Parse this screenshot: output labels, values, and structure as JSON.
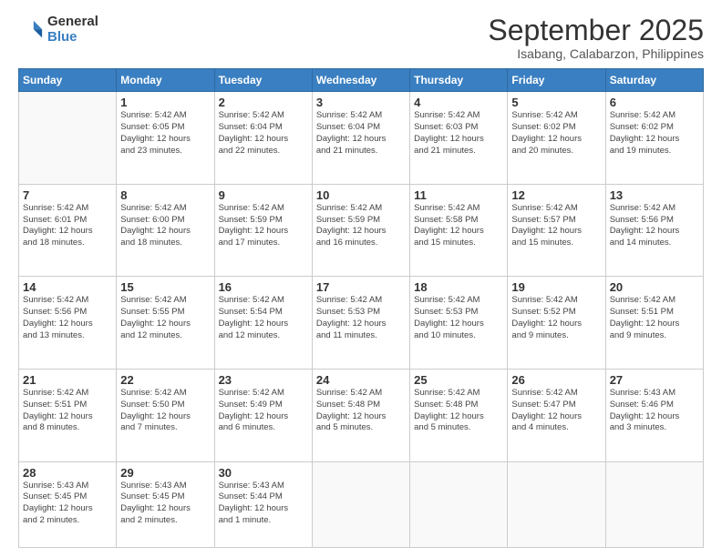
{
  "logo": {
    "general": "General",
    "blue": "Blue"
  },
  "title": "September 2025",
  "subtitle": "Isabang, Calabarzon, Philippines",
  "header_days": [
    "Sunday",
    "Monday",
    "Tuesday",
    "Wednesday",
    "Thursday",
    "Friday",
    "Saturday"
  ],
  "weeks": [
    [
      {
        "day": "",
        "info": ""
      },
      {
        "day": "1",
        "info": "Sunrise: 5:42 AM\nSunset: 6:05 PM\nDaylight: 12 hours\nand 23 minutes."
      },
      {
        "day": "2",
        "info": "Sunrise: 5:42 AM\nSunset: 6:04 PM\nDaylight: 12 hours\nand 22 minutes."
      },
      {
        "day": "3",
        "info": "Sunrise: 5:42 AM\nSunset: 6:04 PM\nDaylight: 12 hours\nand 21 minutes."
      },
      {
        "day": "4",
        "info": "Sunrise: 5:42 AM\nSunset: 6:03 PM\nDaylight: 12 hours\nand 21 minutes."
      },
      {
        "day": "5",
        "info": "Sunrise: 5:42 AM\nSunset: 6:02 PM\nDaylight: 12 hours\nand 20 minutes."
      },
      {
        "day": "6",
        "info": "Sunrise: 5:42 AM\nSunset: 6:02 PM\nDaylight: 12 hours\nand 19 minutes."
      }
    ],
    [
      {
        "day": "7",
        "info": "Sunrise: 5:42 AM\nSunset: 6:01 PM\nDaylight: 12 hours\nand 18 minutes."
      },
      {
        "day": "8",
        "info": "Sunrise: 5:42 AM\nSunset: 6:00 PM\nDaylight: 12 hours\nand 18 minutes."
      },
      {
        "day": "9",
        "info": "Sunrise: 5:42 AM\nSunset: 5:59 PM\nDaylight: 12 hours\nand 17 minutes."
      },
      {
        "day": "10",
        "info": "Sunrise: 5:42 AM\nSunset: 5:59 PM\nDaylight: 12 hours\nand 16 minutes."
      },
      {
        "day": "11",
        "info": "Sunrise: 5:42 AM\nSunset: 5:58 PM\nDaylight: 12 hours\nand 15 minutes."
      },
      {
        "day": "12",
        "info": "Sunrise: 5:42 AM\nSunset: 5:57 PM\nDaylight: 12 hours\nand 15 minutes."
      },
      {
        "day": "13",
        "info": "Sunrise: 5:42 AM\nSunset: 5:56 PM\nDaylight: 12 hours\nand 14 minutes."
      }
    ],
    [
      {
        "day": "14",
        "info": "Sunrise: 5:42 AM\nSunset: 5:56 PM\nDaylight: 12 hours\nand 13 minutes."
      },
      {
        "day": "15",
        "info": "Sunrise: 5:42 AM\nSunset: 5:55 PM\nDaylight: 12 hours\nand 12 minutes."
      },
      {
        "day": "16",
        "info": "Sunrise: 5:42 AM\nSunset: 5:54 PM\nDaylight: 12 hours\nand 12 minutes."
      },
      {
        "day": "17",
        "info": "Sunrise: 5:42 AM\nSunset: 5:53 PM\nDaylight: 12 hours\nand 11 minutes."
      },
      {
        "day": "18",
        "info": "Sunrise: 5:42 AM\nSunset: 5:53 PM\nDaylight: 12 hours\nand 10 minutes."
      },
      {
        "day": "19",
        "info": "Sunrise: 5:42 AM\nSunset: 5:52 PM\nDaylight: 12 hours\nand 9 minutes."
      },
      {
        "day": "20",
        "info": "Sunrise: 5:42 AM\nSunset: 5:51 PM\nDaylight: 12 hours\nand 9 minutes."
      }
    ],
    [
      {
        "day": "21",
        "info": "Sunrise: 5:42 AM\nSunset: 5:51 PM\nDaylight: 12 hours\nand 8 minutes."
      },
      {
        "day": "22",
        "info": "Sunrise: 5:42 AM\nSunset: 5:50 PM\nDaylight: 12 hours\nand 7 minutes."
      },
      {
        "day": "23",
        "info": "Sunrise: 5:42 AM\nSunset: 5:49 PM\nDaylight: 12 hours\nand 6 minutes."
      },
      {
        "day": "24",
        "info": "Sunrise: 5:42 AM\nSunset: 5:48 PM\nDaylight: 12 hours\nand 5 minutes."
      },
      {
        "day": "25",
        "info": "Sunrise: 5:42 AM\nSunset: 5:48 PM\nDaylight: 12 hours\nand 5 minutes."
      },
      {
        "day": "26",
        "info": "Sunrise: 5:42 AM\nSunset: 5:47 PM\nDaylight: 12 hours\nand 4 minutes."
      },
      {
        "day": "27",
        "info": "Sunrise: 5:43 AM\nSunset: 5:46 PM\nDaylight: 12 hours\nand 3 minutes."
      }
    ],
    [
      {
        "day": "28",
        "info": "Sunrise: 5:43 AM\nSunset: 5:45 PM\nDaylight: 12 hours\nand 2 minutes."
      },
      {
        "day": "29",
        "info": "Sunrise: 5:43 AM\nSunset: 5:45 PM\nDaylight: 12 hours\nand 2 minutes."
      },
      {
        "day": "30",
        "info": "Sunrise: 5:43 AM\nSunset: 5:44 PM\nDaylight: 12 hours\nand 1 minute."
      },
      {
        "day": "",
        "info": ""
      },
      {
        "day": "",
        "info": ""
      },
      {
        "day": "",
        "info": ""
      },
      {
        "day": "",
        "info": ""
      }
    ]
  ]
}
